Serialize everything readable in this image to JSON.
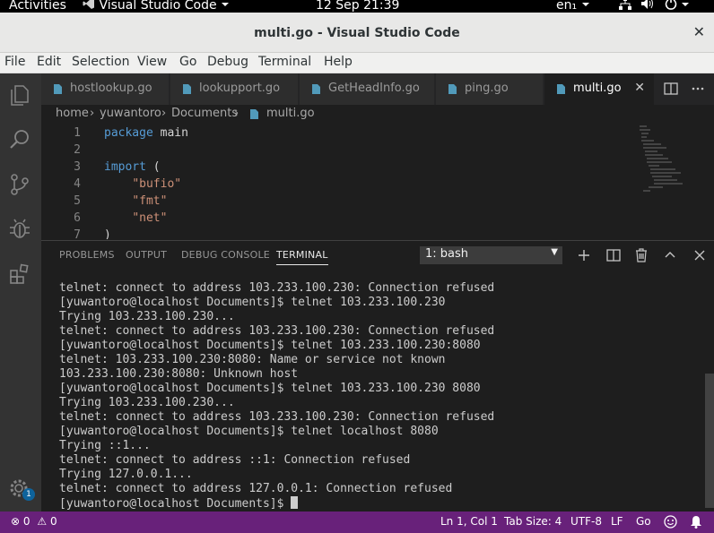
{
  "topbar": {
    "activities": "Activities",
    "app_name": "Visual Studio Code",
    "clock": "12 Sep  21:39",
    "keyboard": "en₁"
  },
  "window": {
    "title": "multi.go - Visual Studio Code",
    "close": "✕"
  },
  "menu": [
    "File",
    "Edit",
    "Selection",
    "View",
    "Go",
    "Debug",
    "Terminal",
    "Help"
  ],
  "activity_bar": {
    "items": [
      "explorer-icon",
      "search-icon",
      "source-control-icon",
      "debug-icon",
      "extensions-icon"
    ],
    "settings_badge": "1"
  },
  "tabs": [
    {
      "label": "hostlookup.go",
      "active": false
    },
    {
      "label": "lookupport.go",
      "active": false
    },
    {
      "label": "GetHeadInfo.go",
      "active": false
    },
    {
      "label": "ping.go",
      "active": false
    },
    {
      "label": "multi.go",
      "active": true
    }
  ],
  "tab_close": "✕",
  "breadcrumb": {
    "parts": [
      "home",
      "yuwantoro",
      "Documents",
      "multi.go"
    ],
    "separator": "›"
  },
  "editor": {
    "lines": [
      {
        "n": "1",
        "parts": [
          {
            "t": "package",
            "k": "kw"
          },
          {
            "t": " main",
            "k": ""
          }
        ]
      },
      {
        "n": "2",
        "parts": []
      },
      {
        "n": "3",
        "parts": [
          {
            "t": "import",
            "k": "kw"
          },
          {
            "t": " (",
            "k": ""
          }
        ]
      },
      {
        "n": "4",
        "parts": [
          {
            "t": "    ",
            "k": ""
          },
          {
            "t": "\"bufio\"",
            "k": "str"
          }
        ]
      },
      {
        "n": "5",
        "parts": [
          {
            "t": "    ",
            "k": ""
          },
          {
            "t": "\"fmt\"",
            "k": "str"
          }
        ]
      },
      {
        "n": "6",
        "parts": [
          {
            "t": "    ",
            "k": ""
          },
          {
            "t": "\"net\"",
            "k": "str"
          }
        ]
      },
      {
        "n": "7",
        "parts": [
          {
            "t": ")",
            "k": ""
          }
        ]
      }
    ]
  },
  "panel": {
    "tabs": [
      "PROBLEMS",
      "OUTPUT",
      "DEBUG CONSOLE",
      "TERMINAL"
    ],
    "active_tab": "TERMINAL",
    "terminal_select": "1: bash",
    "dropdown_arrow": "▼"
  },
  "terminal": {
    "lines": [
      "telnet: connect to address 103.233.100.230: Connection refused",
      "[yuwantoro@localhost Documents]$ telnet 103.233.100.230",
      "Trying 103.233.100.230...",
      "telnet: connect to address 103.233.100.230: Connection refused",
      "[yuwantoro@localhost Documents]$ telnet 103.233.100.230:8080",
      "telnet: 103.233.100.230:8080: Name or service not known",
      "103.233.100.230:8080: Unknown host",
      "[yuwantoro@localhost Documents]$ telnet 103.233.100.230 8080",
      "Trying 103.233.100.230...",
      "telnet: connect to address 103.233.100.230: Connection refused",
      "[yuwantoro@localhost Documents]$ telnet localhost 8080",
      "Trying ::1...",
      "telnet: connect to address ::1: Connection refused",
      "Trying 127.0.0.1...",
      "telnet: connect to address 127.0.0.1: Connection refused"
    ],
    "prompt": "[yuwantoro@localhost Documents]$ "
  },
  "statusbar": {
    "errors": "0",
    "warnings": "0",
    "position": "Ln 1, Col 1",
    "tab_size": "Tab Size: 4",
    "encoding": "UTF-8",
    "eol": "LF",
    "language": "Go",
    "error_glyph": "⊗",
    "warning_glyph": "⚠"
  },
  "colors": {
    "accent": "#68217a",
    "go_icon": "#519aba"
  }
}
